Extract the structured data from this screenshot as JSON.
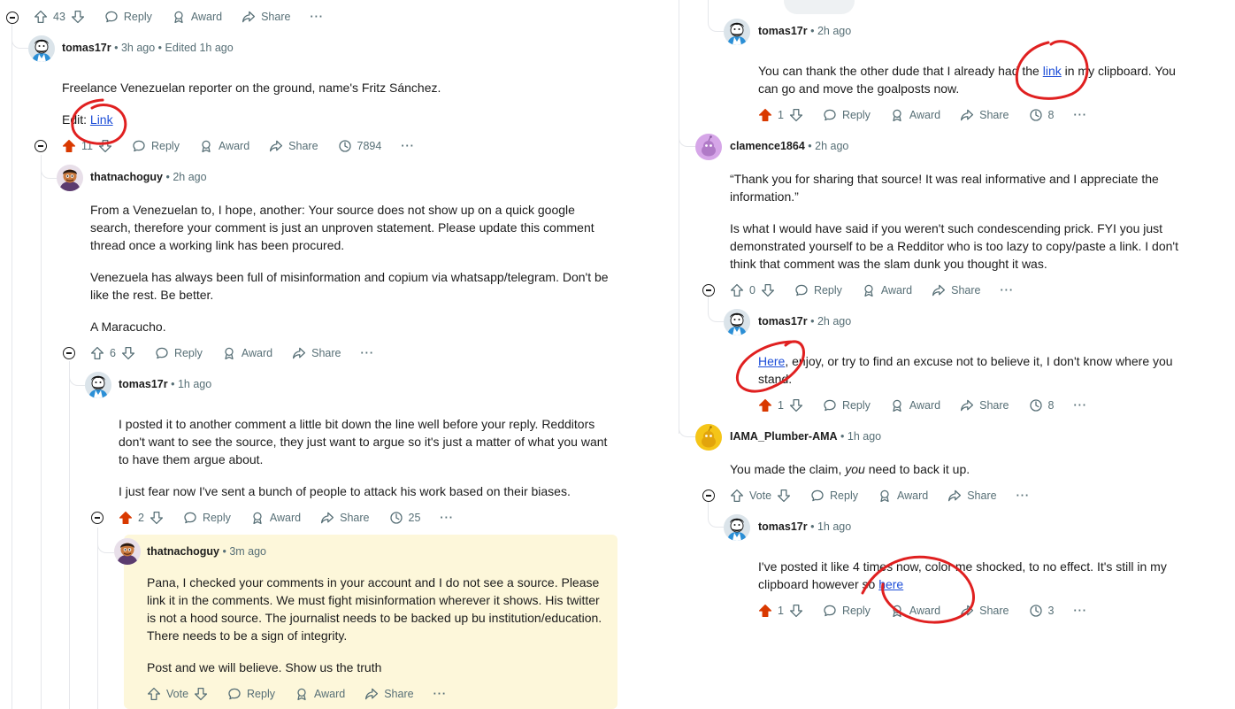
{
  "labels": {
    "reply": "Reply",
    "award": "Award",
    "share": "Share",
    "vote": "Vote",
    "more": "···",
    "dot": "•"
  },
  "left": {
    "top_bar": {
      "score": "43"
    },
    "c1": {
      "user": "tomas17r",
      "time": "3h ago",
      "edited": "Edited 1h ago",
      "text": "Freelance Venezuelan reporter on the ground, name's Fritz Sánchez.",
      "edit_prefix": "Edit: ",
      "edit_link": "Link",
      "score": "11",
      "views": "7894"
    },
    "c2": {
      "user": "thatnachoguy",
      "time": "2h ago",
      "p1": "From a Venezuelan to, I hope, another: Your source does not show up on a quick google search, therefore your comment is just an unproven statement. Please update this comment thread once a working link has been procured.",
      "p2": "Venezuela has always been full of misinformation and copium via whatsapp/telegram. Don't be like the rest. Be better.",
      "p3": "A Maracucho.",
      "score": "6"
    },
    "c3": {
      "user": "tomas17r",
      "time": "1h ago",
      "p1": "I posted it to another comment a little bit down the line well before your reply. Redditors don't want to see the source, they just want to argue so it's just a matter of what you want to have them argue about.",
      "p2": "I just fear now I've sent a bunch of people to attack his work based on their biases.",
      "score": "2",
      "views": "25"
    },
    "c4": {
      "user": "thatnachoguy",
      "time": "3m ago",
      "p1": "Pana, I checked your comments in your account and I do not see a source. Please link it in the comments. We must fight misinformation wherever it shows. His twitter is not a hood source. The journalist needs to be backed up bu institution/education. There needs to be a sign of integrity.",
      "p2": "Post and we will believe. Show us the truth"
    }
  },
  "right": {
    "r1": {
      "user": "tomas17r",
      "time": "2h ago",
      "text_before": "You can thank the other dude that I already had the ",
      "link": "link",
      "text_after": " in my clipboard. You can go and move the goalposts now.",
      "score": "1",
      "views": "8"
    },
    "r2": {
      "user": "clamence1864",
      "time": "2h ago",
      "p1": "“Thank you for sharing that source! It was real informative and I appreciate the information.”",
      "p2": "Is what I would have said if you weren't such condescending prick. FYI you just demonstrated yourself to be a Redditor who is too lazy to copy/paste a link. I don't think that comment was the slam dunk you thought it was.",
      "score": "0"
    },
    "r3": {
      "user": "tomas17r",
      "time": "2h ago",
      "link": "Here",
      "text_after": ", enjoy, or try to find an excuse not to believe it, I don't know where you stand.",
      "score": "1",
      "views": "8"
    },
    "r4": {
      "user": "IAMA_Plumber-AMA",
      "time": "1h ago",
      "text_before": "You made the claim, ",
      "em": "you",
      "text_after": " need to back it up."
    },
    "r5": {
      "user": "tomas17r",
      "time": "1h ago",
      "text_before": "I've posted it like 4 times now, color me shocked, to no effect. It's still in my clipboard however so ",
      "link": "here",
      "score": "1",
      "views": "3"
    }
  },
  "colors": {
    "upvoted": "#d93900",
    "annotation": "#e02020",
    "highlight": "#fdf7da",
    "link": "#1d4ed8",
    "meta": "#576f76"
  }
}
